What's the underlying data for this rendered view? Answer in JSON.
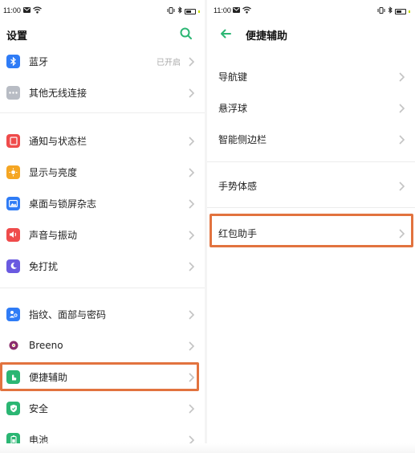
{
  "status_left": {
    "time": "11:00"
  },
  "status_right": {
    "time": "11:00"
  },
  "settings": {
    "title": "设置",
    "items": [
      {
        "label": "蓝牙",
        "value": "已开启",
        "icon": "bluetooth-icon",
        "color": "#2f7cf6"
      },
      {
        "label": "其他无线连接",
        "icon": "dots-icon",
        "color": "#b8bcc4"
      },
      {
        "label": "通知与状态栏",
        "icon": "notification-icon",
        "color": "#ef4b4b"
      },
      {
        "label": "显示与亮度",
        "icon": "brightness-icon",
        "color": "#f5a623"
      },
      {
        "label": "桌面与锁屏杂志",
        "icon": "wallpaper-icon",
        "color": "#2f7cf6"
      },
      {
        "label": "声音与振动",
        "icon": "sound-icon",
        "color": "#ef4b4b"
      },
      {
        "label": "免打扰",
        "icon": "moon-icon",
        "color": "#6a5ae0"
      },
      {
        "label": "指纹、面部与密码",
        "icon": "fingerprint-icon",
        "color": "#2f7cf6"
      },
      {
        "label": "Breeno",
        "icon": "breeno-icon",
        "color": "#8a2b6b"
      },
      {
        "label": "便捷辅助",
        "icon": "assist-icon",
        "color": "#2bb673"
      },
      {
        "label": "安全",
        "icon": "shield-icon",
        "color": "#2bb673"
      },
      {
        "label": "电池",
        "icon": "battery-icon",
        "color": "#2bb673"
      }
    ]
  },
  "assist": {
    "title": "便捷辅助",
    "items": [
      {
        "label": "导航键"
      },
      {
        "label": "悬浮球"
      },
      {
        "label": "智能侧边栏"
      },
      {
        "label": "手势体感"
      },
      {
        "label": "红包助手"
      }
    ]
  },
  "colors": {
    "accent": "#2bb673",
    "highlight": "#e2733f"
  }
}
